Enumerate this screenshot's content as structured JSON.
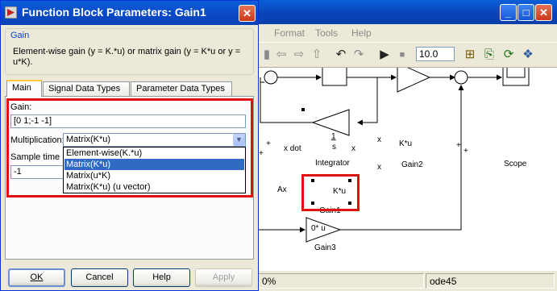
{
  "dialog": {
    "title": "Function Block Parameters: Gain1",
    "group_label": "Gain",
    "description": "Element-wise gain (y = K.*u) or matrix gain (y = K*u or y = u*K).",
    "tabs": [
      {
        "label": "Main"
      },
      {
        "label": "Signal Data Types"
      },
      {
        "label": "Parameter Data Types"
      }
    ],
    "gain_label": "Gain:",
    "gain_value": "[0 1;-1 -1]",
    "multiplication_label": "Multiplication:",
    "multiplication_value": "Matrix(K*u)",
    "multiplication_options": [
      "Element-wise(K.*u)",
      "Matrix(K*u)",
      "Matrix(u*K)",
      "Matrix(K*u) (u vector)"
    ],
    "selected_option_index": 1,
    "sample_time_label": "Sample time (",
    "sample_time_value": "-1",
    "buttons": {
      "ok": "OK",
      "cancel": "Cancel",
      "help": "Help",
      "apply": "Apply"
    }
  },
  "model_window": {
    "menu": [
      "Format",
      "Tools",
      "Help"
    ],
    "stop_time": "10.0",
    "status": {
      "zoom": "0%",
      "solver": "ode45"
    }
  },
  "diagram": {
    "blocks": {
      "integrator_num": "1",
      "integrator_den": "s",
      "integrator": "Integrator",
      "gain": "K*u",
      "gain_name": "Gain2",
      "gain1": "K*u",
      "gain1_name": "Gain1",
      "gain3": "0* u",
      "gain3_name": "Gain3",
      "scope": "Scope"
    },
    "signals": {
      "xdot": "x dot",
      "x1": "x",
      "x2": "x",
      "x3": "x",
      "ax": "Ax"
    },
    "sum_signs": {
      "s1": "+",
      "s2": "+",
      "s3": "+",
      "s4": "+"
    }
  },
  "colors": {
    "highlight": "#e01010",
    "titlebar": "#0a4ac8",
    "selection": "#316ac5"
  }
}
